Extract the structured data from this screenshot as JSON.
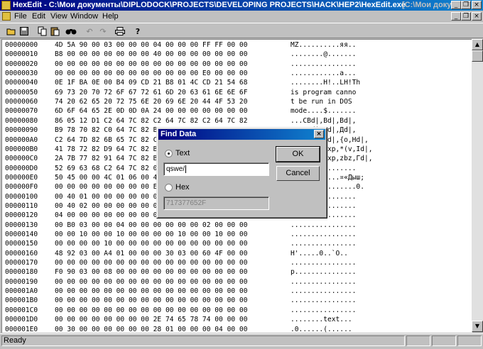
{
  "window": {
    "title": "HexEdit - C:\\Мои документы\\DIPLODOCK\\PROJECTS\\DEVELOPING PROJECTS\\HACK\\HEP2\\HexEdit.exe",
    "child_title": "[C:\\Мои доку",
    "min_glyph": "_",
    "max_glyph": "❐",
    "close_glyph": "×"
  },
  "menu": [
    "File",
    "Edit",
    "View",
    "Window",
    "Help"
  ],
  "toolbar": {
    "icons": [
      "open-icon",
      "save-icon",
      "copy-icon",
      "paste-icon",
      "find-icon",
      "undo-icon",
      "redo-icon",
      "print-icon",
      "help-icon"
    ]
  },
  "hex_rows": [
    {
      "addr": "00000000",
      "bytes": "4D 5A 90 00 03 00 00 00 04 00 00 00 FF FF 00 00",
      "ascii": "MZ..........яя.."
    },
    {
      "addr": "00000010",
      "bytes": "B8 00 00 00 00 00 00 00 40 00 00 00 00 00 00 00",
      "ascii": "........@......."
    },
    {
      "addr": "00000020",
      "bytes": "00 00 00 00 00 00 00 00 00 00 00 00 00 00 00 00",
      "ascii": "................"
    },
    {
      "addr": "00000030",
      "bytes": "00 00 00 00 00 00 00 00 00 00 00 00 E0 00 00 00",
      "ascii": "............а..."
    },
    {
      "addr": "00000040",
      "bytes": "0E 1F BA 0E 00 B4 09 CD 21 B8 01 4C CD 21 54 68",
      "ascii": "........H!..LH!Th"
    },
    {
      "addr": "00000050",
      "bytes": "69 73 20 70 72 6F 67 72 61 6D 20 63 61 6E 6E 6F",
      "ascii": "is program canno"
    },
    {
      "addr": "00000060",
      "bytes": "74 20 62 65 20 72 75 6E 20 69 6E 20 44 4F 53 20",
      "ascii": "t be run in DOS "
    },
    {
      "addr": "00000070",
      "bytes": "6D 6F 64 65 2E 0D 0D 0A 24 00 00 00 00 00 00 00",
      "ascii": "mode....$......."
    },
    {
      "addr": "00000080",
      "bytes": "86 05 12 D1 C2 64 7C 82 C2 64 7C 82 C2 64 7C 82",
      "ascii": "...CBd|,Bd|,Bd|,"
    },
    {
      "addr": "00000090",
      "bytes": "B9 78 70 82 C0 64 7C 82 B9 78 70 82 C0 64 7C 82",
      "ascii": "Fxp,Bd|,Bd|,Дd|,"
    },
    {
      "addr": "000000A0",
      "bytes": "C2 64 7D 82 6B 65 7C 82 C2 64 7C 82 B0 64 7C 82",
      "ascii": "Bd},ke|,Bd|,{o,Hd|,"
    },
    {
      "addr": "000000B0",
      "bytes": "41 78 72 82 D9 64 7C 82 B9 78 70 82 2A 28 76 2C",
      "ascii": "Axr,Щd|,Fxp,*(v,Id|,"
    },
    {
      "addr": "000000C0",
      "bytes": "2A 7B 77 82 91 64 7C 82 B9 78 70 82 7A 62 7A 2C",
      "ascii": "*{w,'d|,Fxp,zbz,Гd|,"
    },
    {
      "addr": "000000D0",
      "bytes": "52 69 63 68 C2 64 7C 82 00 00 00 00 00 00 00 00",
      "ascii": "RichBd|,........"
    },
    {
      "addr": "000000E0",
      "bytes": "50 45 00 00 4C 01 06 00 4C 01 06 00 A4 AB BE 38",
      "ascii": "PE..L...L...¤«Дыш;"
    },
    {
      "addr": "000000F0",
      "bytes": "00 00 00 00 00 00 00 00 E0 00 0F 01 0B 01 05 00",
      "ascii": "........а.......0."
    },
    {
      "addr": "00000100",
      "bytes": "00 40 01 00 00 00 00 00 00 00 00 00 00 00 00 00",
      "ascii": "................"
    },
    {
      "addr": "00000110",
      "bytes": "00 40 02 00 00 00 00 00 00 40 00 00 00 00 00 00",
      "ascii": "................"
    },
    {
      "addr": "00000120",
      "bytes": "04 00 00 00 00 00 00 00 04 00 00 00 00 00 00 00",
      "ascii": "................"
    },
    {
      "addr": "00000130",
      "bytes": "00 B0 03 00 00 04 00 00 00 00 00 00 02 00 00 00",
      "ascii": "................"
    },
    {
      "addr": "00000140",
      "bytes": "00 00 10 00 00 10 00 00 00 00 10 00 00 10 00 00",
      "ascii": "................"
    },
    {
      "addr": "00000150",
      "bytes": "00 00 00 00 10 00 00 00 00 00 00 00 00 00 00 00",
      "ascii": "................"
    },
    {
      "addr": "00000160",
      "bytes": "48 92 03 00 A4 01 00 00 00 30 03 00 60 4F 00 00",
      "ascii": "H'.....0..`O.."
    },
    {
      "addr": "00000170",
      "bytes": "00 00 00 00 00 00 00 00 00 00 00 00 00 00 00 00",
      "ascii": "................"
    },
    {
      "addr": "00000180",
      "bytes": "F0 90 03 00 08 00 00 00 00 00 00 00 00 00 00 00",
      "ascii": "p..............."
    },
    {
      "addr": "00000190",
      "bytes": "00 00 00 00 00 00 00 00 00 00 00 00 00 00 00 00",
      "ascii": "................"
    },
    {
      "addr": "000001A0",
      "bytes": "00 00 00 00 00 00 00 00 00 00 00 00 00 00 00 00",
      "ascii": "................"
    },
    {
      "addr": "000001B0",
      "bytes": "00 00 00 00 00 00 00 00 00 00 00 00 00 00 00 00",
      "ascii": "................"
    },
    {
      "addr": "000001C0",
      "bytes": "00 00 00 00 00 00 00 00 00 00 00 00 00 00 00 00",
      "ascii": "................"
    },
    {
      "addr": "000001D0",
      "bytes": "00 00 00 00 00 00 00 00 2E 74 65 78 74 00 00 00",
      "ascii": "........text..."
    },
    {
      "addr": "000001E0",
      "bytes": "00 30 00 00 00 00 00 00 28 01 00 00 00 04 00 00",
      "ascii": ".0......(......"
    }
  ],
  "dialog": {
    "title": "Find Data",
    "text_option": "Text",
    "text_value": "qswe/",
    "hex_option": "Hex",
    "hex_value": "717377652F",
    "ok": "OK",
    "cancel": "Cancel"
  },
  "scrollbar": {
    "up_glyph": "▲",
    "down_glyph": "▼"
  },
  "status": {
    "text": "Ready"
  }
}
